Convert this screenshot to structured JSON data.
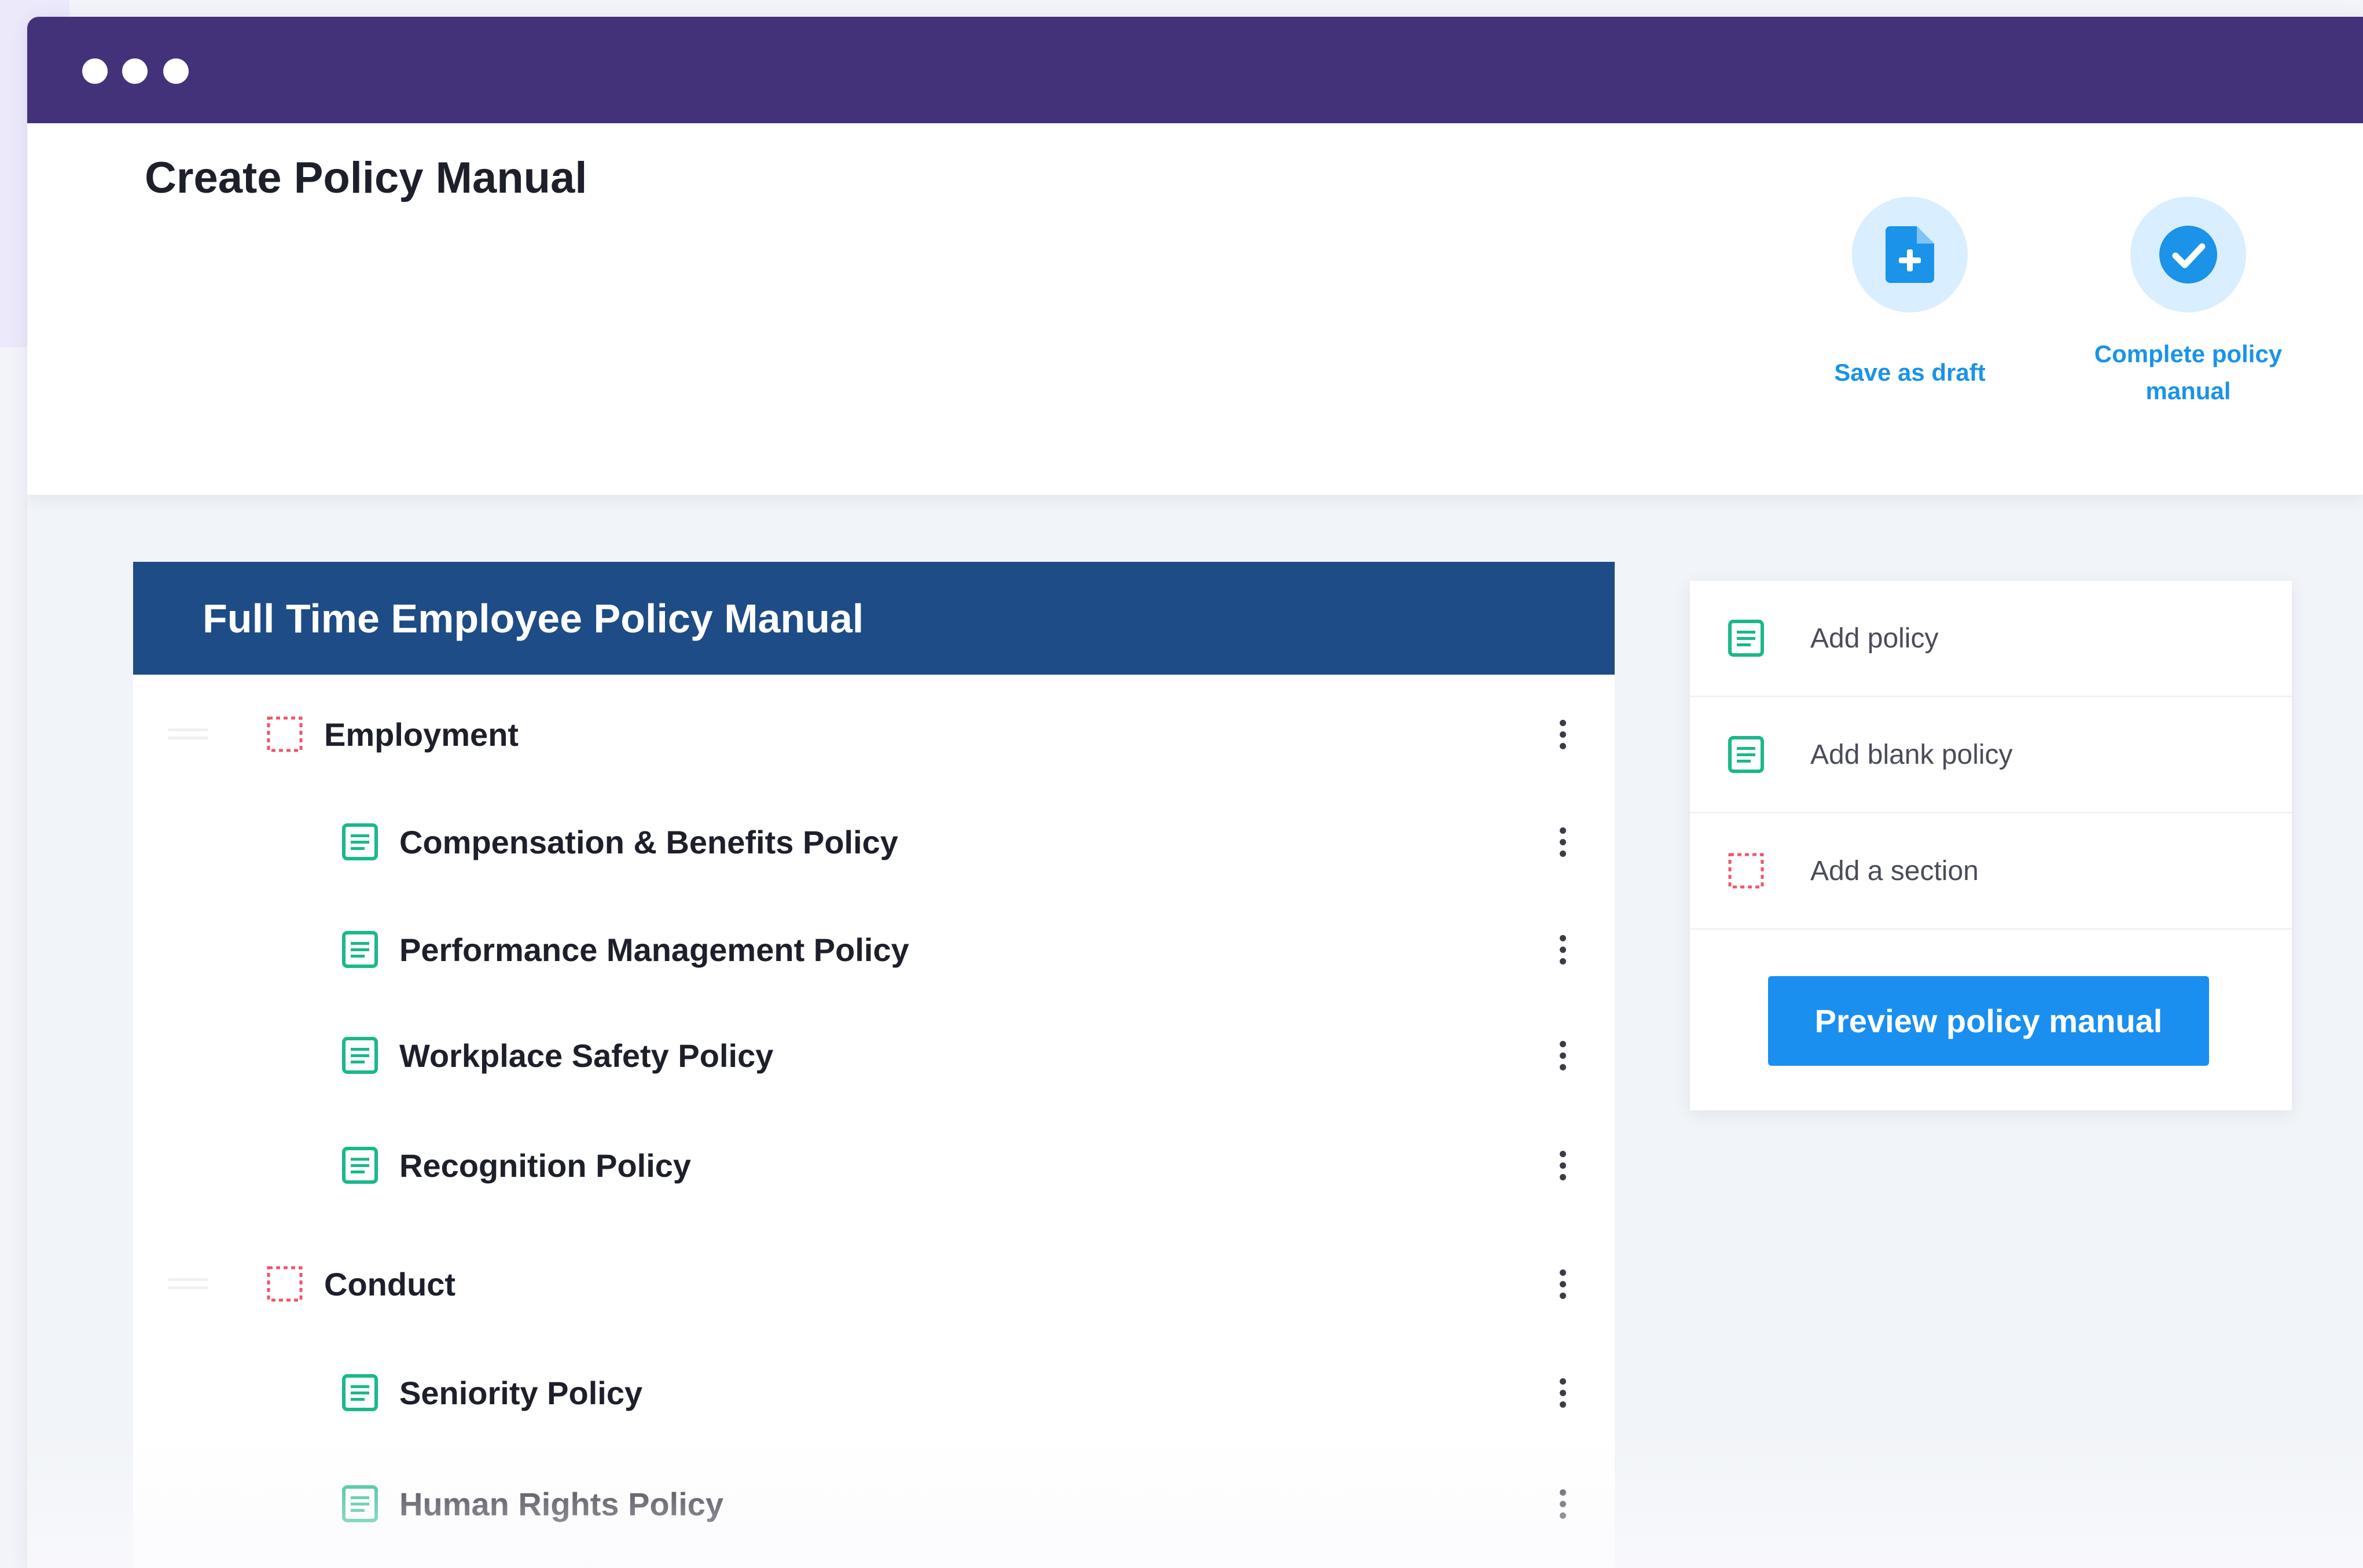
{
  "page_title": "Create Policy Manual",
  "header_actions": {
    "save_draft": {
      "label": "Save as draft",
      "icon": "document-add-icon"
    },
    "complete": {
      "label_line1": "Complete policy",
      "label_line2": "manual",
      "icon": "check-circle-icon"
    }
  },
  "manual": {
    "title": "Full Time Employee Policy Manual",
    "items": [
      {
        "type": "section",
        "label": "Employment"
      },
      {
        "type": "policy",
        "label": "Compensation & Benefits Policy"
      },
      {
        "type": "policy",
        "label": "Performance Management Policy"
      },
      {
        "type": "policy",
        "label": "Workplace Safety Policy"
      },
      {
        "type": "policy",
        "label": "Recognition Policy"
      },
      {
        "type": "section",
        "label": "Conduct"
      },
      {
        "type": "policy",
        "label": "Seniority Policy"
      },
      {
        "type": "policy",
        "label": "Human Rights Policy"
      }
    ]
  },
  "side_panel": {
    "add_policy": "Add policy",
    "add_blank_policy": "Add blank policy",
    "add_section": "Add a section",
    "preview_button": "Preview policy manual"
  },
  "colors": {
    "titlebar": "#43317a",
    "manual_header": "#1e4c86",
    "accent_blue": "#1a8ff0",
    "policy_icon": "#19b98a",
    "section_icon": "#f0566a"
  }
}
